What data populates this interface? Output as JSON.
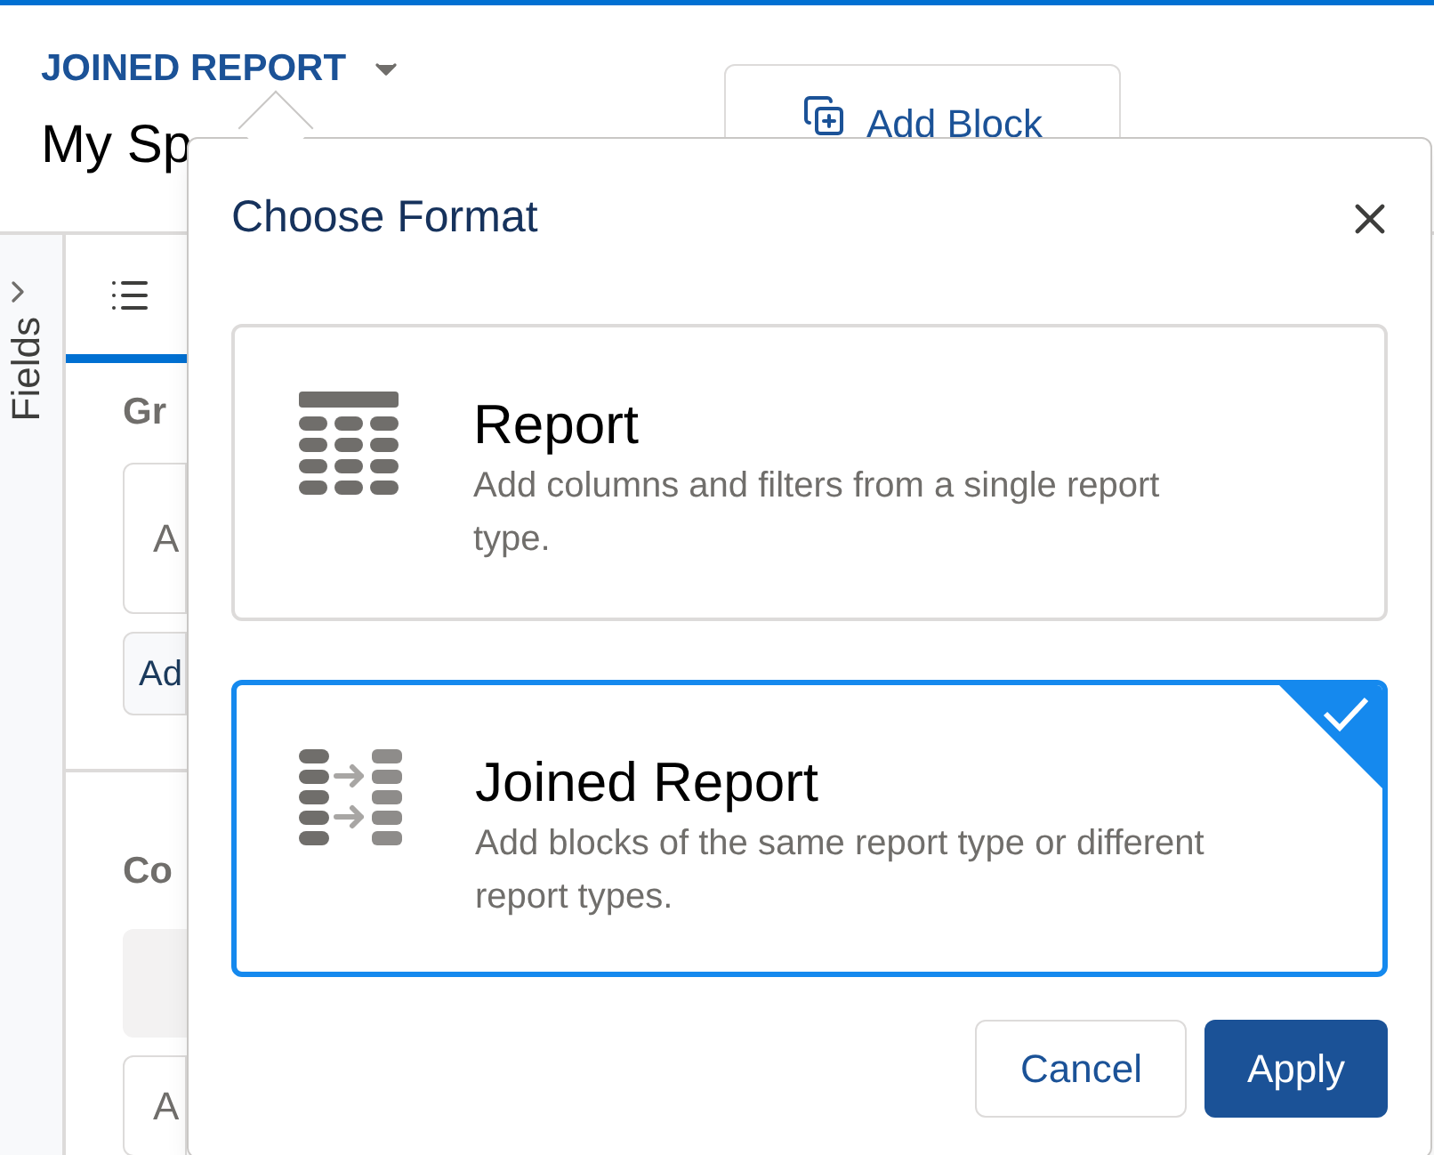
{
  "header": {
    "report_type": "JOINED REPORT",
    "title": "My Sp"
  },
  "add_block_button": {
    "label": "Add Block"
  },
  "sidebar": {
    "label": "Fields"
  },
  "panel": {
    "tab": {
      "selected": true
    },
    "section_1_heading": "Gr",
    "section_1_field": "A",
    "section_1_button": "Ad",
    "section_2_heading": "Co",
    "section_2_field": "A"
  },
  "dialog": {
    "title": "Choose Format",
    "options": [
      {
        "kind": "report",
        "title": "Report",
        "description": "Add columns and filters from a single report type.",
        "selected": false
      },
      {
        "kind": "joined",
        "title": "Joined Report",
        "description": "Add blocks of the same report type or different report types.",
        "selected": true
      }
    ],
    "buttons": [
      {
        "label": "Cancel",
        "kind": "secondary"
      },
      {
        "label": "Apply",
        "kind": "primary"
      }
    ]
  }
}
